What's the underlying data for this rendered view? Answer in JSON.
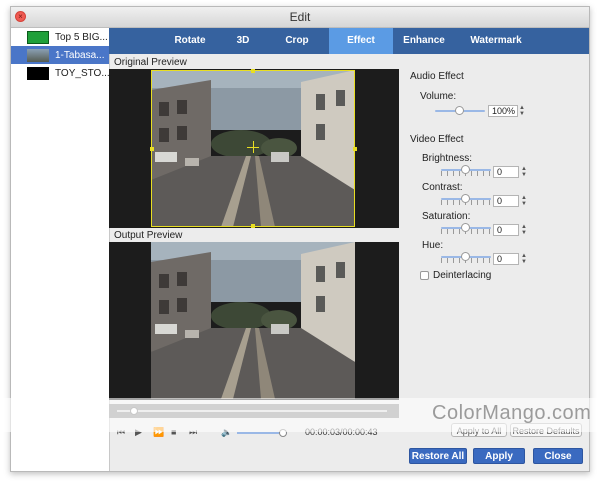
{
  "window": {
    "title": "Edit"
  },
  "sidebar": {
    "items": [
      {
        "label": "Top 5 BIG...",
        "thumb_color": "#1fa03a"
      },
      {
        "label": "1-Tabasa...",
        "thumb_color": "#7b8a96"
      },
      {
        "label": "TOY_STO...",
        "thumb_color": "#000000"
      }
    ],
    "selected_index": 1
  },
  "tabs": [
    {
      "label": "Rotate"
    },
    {
      "label": "3D"
    },
    {
      "label": "Crop"
    },
    {
      "label": "Effect"
    },
    {
      "label": "Enhance"
    },
    {
      "label": "Watermark"
    }
  ],
  "active_tab": "Effect",
  "preview": {
    "original_label": "Original Preview",
    "output_label": "Output Preview"
  },
  "audio": {
    "section_label": "Audio Effect",
    "volume_label": "Volume:",
    "volume_value": "100%",
    "volume_level": 0.35
  },
  "video": {
    "section_label": "Video Effect",
    "brightness_label": "Brightness:",
    "brightness_value": "0",
    "contrast_label": "Contrast:",
    "contrast_value": "0",
    "saturation_label": "Saturation:",
    "saturation_value": "0",
    "hue_label": "Hue:",
    "hue_value": "0",
    "deinterlacing_label": "Deinterlacing",
    "deinterlacing_checked": false
  },
  "player": {
    "progress_fraction": 0.07,
    "time": "00:00:03/00:00:43",
    "volume_level": 0.75
  },
  "buttons": {
    "apply_to_all": "Apply to All",
    "restore_defaults": "Restore Defaults",
    "restore_all": "Restore All",
    "apply": "Apply",
    "close": "Close"
  },
  "watermark": {
    "text": "ColorMango.com"
  },
  "colors": {
    "tab_bar": "#36629f",
    "active_tab": "#5b9be4",
    "selection": "#4a76c8",
    "crop_border": "#e8de22"
  }
}
